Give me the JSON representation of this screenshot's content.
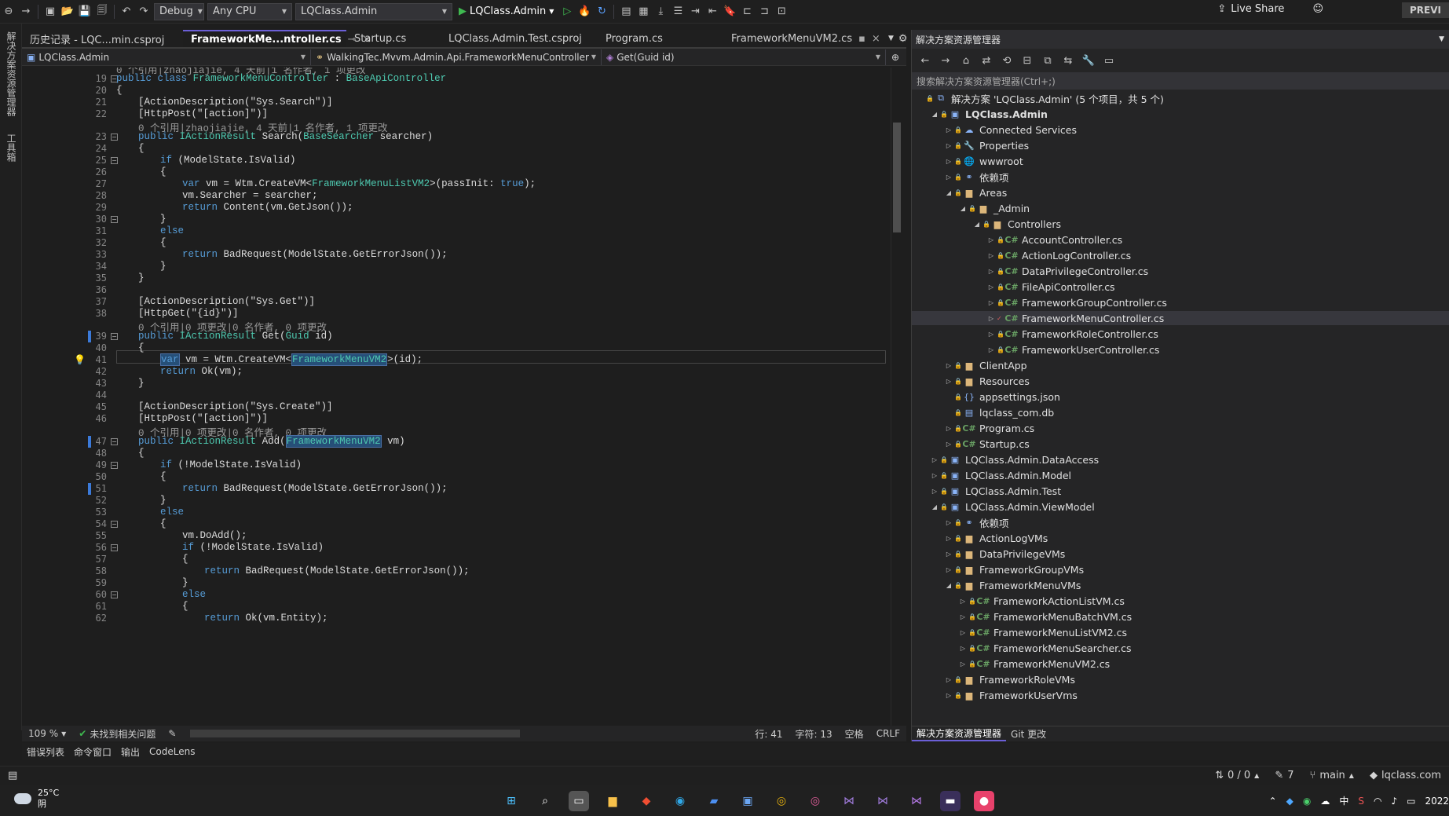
{
  "toolbar": {
    "config": "Debug",
    "platform": "Any CPU",
    "startup_project": "LQClass.Admin",
    "run_target": "LQClass.Admin",
    "live_share": "Live Share",
    "preview": "PREVI"
  },
  "left_strip": {
    "item1": "解决方案资源管理器",
    "item2": "工具箱"
  },
  "tabs": [
    {
      "label": "历史记录 - LQC...min.csproj"
    },
    {
      "label": "FrameworkMe...ntroller.cs",
      "active": true,
      "close": "×"
    },
    {
      "label": "Startup.cs"
    },
    {
      "label": "LQClass.Admin.Test.csproj"
    },
    {
      "label": "Program.cs"
    },
    {
      "label": "FrameworkMenuVM2.cs",
      "close": "×"
    }
  ],
  "nav": {
    "project": "LQClass.Admin",
    "class": "WalkingTec.Mvvm.Admin.Api.FrameworkMenuController",
    "member": "Get(Guid id)"
  },
  "code": {
    "lens_top": "0 个引用|zhaojiajie, 4 天前|1 名作者, 1 项更改",
    "l19a": "public",
    "l19b": "class",
    "l19c": "FrameworkMenuController",
    "l19d": "BaseApiController",
    "l21": "[ActionDescription(\"Sys.Search\")]",
    "l22": "[HttpPost(\"[action]\")]",
    "lens22": "0 个引用|zhaojiajie, 4 天前|1 名作者, 1 项更改",
    "l23a": "public",
    "l23b": "IActionResult",
    "l23c": "Search(",
    "l23d": "BaseSearcher",
    "l23e": "searcher)",
    "l24": "{",
    "l25": "if (ModelState.IsValid)",
    "l26": "{",
    "l27a": "var",
    "l27b": "vm = Wtm.CreateVM<",
    "l27c": "FrameworkMenuListVM2",
    "l27d": ">(passInit: ",
    "l27e": "true",
    "l27f": ");",
    "l28": "vm.Searcher = searcher;",
    "l29a": "return",
    "l29b": "Content(vm.GetJson());",
    "l30": "}",
    "l31": "else",
    "l32": "{",
    "l33a": "return",
    "l33b": "BadRequest(ModelState.GetErrorJson());",
    "l34": "}",
    "l35": "}",
    "l37": "[ActionDescription(\"Sys.Get\")]",
    "l38": "[HttpGet(\"{id}\")]",
    "lens38": "0 个引用|0 项更改|0 名作者, 0 项更改",
    "l39a": "public",
    "l39b": "IActionResult",
    "l39c": "Get(",
    "l39d": "Guid",
    "l39e": "id)",
    "l40": "{",
    "l41a": "var",
    "l41b": " vm = Wtm.CreateVM<",
    "l41c": "FrameworkMenuVM2",
    "l41d": ">(id);",
    "l42a": "return",
    "l42b": "Ok(vm);",
    "l43": "}",
    "l45": "[ActionDescription(\"Sys.Create\")]",
    "l46": "[HttpPost(\"[action]\")]",
    "lens46": "0 个引用|0 项更改|0 名作者, 0 项更改",
    "l47a": "public",
    "l47b": "IActionResult",
    "l47c": "Add(",
    "l47d": "FrameworkMenuVM2",
    "l47e": " vm)",
    "l48": "{",
    "l49": "if (!ModelState.IsValid)",
    "l50": "{",
    "l51a": "return",
    "l51b": "BadRequest(ModelState.GetErrorJson());",
    "l52": "}",
    "l53": "else",
    "l54": "{",
    "l55": "vm.DoAdd();",
    "l56": "if (!ModelState.IsValid)",
    "l57": "{",
    "l58a": "return",
    "l58b": "BadRequest(ModelState.GetErrorJson());",
    "l59": "}",
    "l60": "else",
    "l61": "{",
    "l62a": "return",
    "l62b": "Ok(vm.Entity);"
  },
  "line_numbers": [
    "19",
    "20",
    "21",
    "22",
    "23",
    "24",
    "25",
    "26",
    "27",
    "28",
    "29",
    "30",
    "31",
    "32",
    "33",
    "34",
    "35",
    "36",
    "37",
    "38",
    "39",
    "40",
    "41",
    "42",
    "43",
    "44",
    "45",
    "46",
    "47",
    "48",
    "49",
    "50",
    "51",
    "52",
    "53",
    "54",
    "55",
    "56",
    "57",
    "58",
    "59",
    "60",
    "61",
    "62"
  ],
  "editor_status": {
    "zoom": "109 %",
    "issues": "未找到相关问题",
    "line": "行: 41",
    "col": "字符: 13",
    "spaces": "空格",
    "eol": "CRLF"
  },
  "solution": {
    "title": "解决方案资源管理器",
    "search_placeholder": "搜索解决方案资源管理器(Ctrl+;)",
    "root": "解决方案 'LQClass.Admin' (5 个项目，共 5 个)",
    "items": {
      "admin": "LQClass.Admin",
      "connected": "Connected Services",
      "properties": "Properties",
      "wwwroot": "wwwroot",
      "deps": "依赖项",
      "areas": "Areas",
      "_admin": "_Admin",
      "controllers": "Controllers",
      "c1": "AccountController.cs",
      "c2": "ActionLogController.cs",
      "c3": "DataPrivilegeController.cs",
      "c4": "FileApiController.cs",
      "c5": "FrameworkGroupController.cs",
      "c6": "FrameworkMenuController.cs",
      "c7": "FrameworkRoleController.cs",
      "c8": "FrameworkUserController.cs",
      "clientapp": "ClientApp",
      "resources": "Resources",
      "appsettings": "appsettings.json",
      "db": "lqclass_com.db",
      "program": "Program.cs",
      "startup": "Startup.cs",
      "dataaccess": "LQClass.Admin.DataAccess",
      "model": "LQClass.Admin.Model",
      "test": "LQClass.Admin.Test",
      "viewmodel": "LQClass.Admin.ViewModel",
      "vm_deps": "依赖项",
      "actionlogvms": "ActionLogVMs",
      "dataprivvms": "DataPrivilegeVMs",
      "groupvms": "FrameworkGroupVMs",
      "menuvms": "FrameworkMenuVMs",
      "m1": "FrameworkActionListVM.cs",
      "m2": "FrameworkMenuBatchVM.cs",
      "m3": "FrameworkMenuListVM2.cs",
      "m4": "FrameworkMenuSearcher.cs",
      "m5": "FrameworkMenuVM2.cs",
      "rolevms": "FrameworkRoleVMs",
      "uservms": "FrameworkUserVms"
    },
    "tab1": "解决方案资源管理器",
    "tab2": "Git 更改"
  },
  "bottom_tabs": [
    "错误列表",
    "命令窗口",
    "输出",
    "CodeLens"
  ],
  "statusbar": {
    "sync": "0 / 0",
    "edits": "7",
    "branch": "main",
    "repo": "lqclass.com"
  },
  "taskbar": {
    "temp": "25°C",
    "weather": "阴",
    "ime": "中",
    "year": "2022"
  }
}
